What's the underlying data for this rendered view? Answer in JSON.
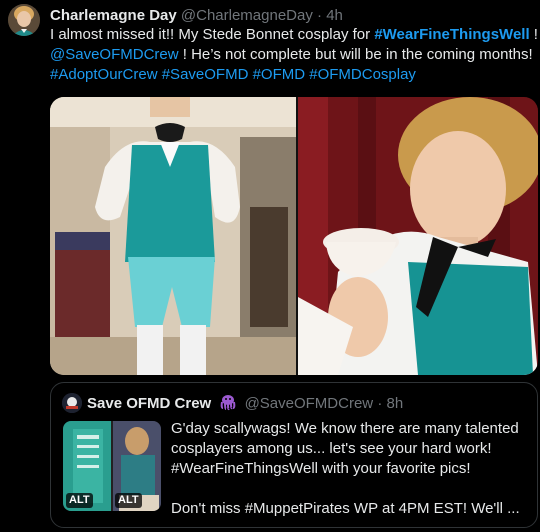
{
  "tweet": {
    "author_name": "Charlemagne Day",
    "author_handle": "@CharlemagneDay",
    "separator": "·",
    "time": "4h",
    "line1_pre": "I almost missed it!! My Stede Bonnet cosplay for ",
    "line1_tag": "#WearFineThingsWell",
    "line1_post": " !",
    "line2_mention": "@SaveOFMDCrew",
    "line2_text": " ! He’s not complete but will be in the coming months!",
    "line3_tags": "#AdoptOurCrew #SaveOFMD  #OFMD #OFMDCosplay"
  },
  "quote": {
    "author_name": "Save OFMD Crew",
    "emoji": "octopus-emoji",
    "author_handle": "@SaveOFMDCrew",
    "separator": "·",
    "time": "8h",
    "alt_badge_1": "ALT",
    "alt_badge_2": "ALT",
    "lines": [
      "G'day scallywags! We know there are many talented",
      "cosplayers among us... let's see your hard work!",
      "#WearFineThingsWell with your favorite pics!",
      "",
      "Don't miss #MuppetPirates WP at 4PM EST! We'll ..."
    ]
  },
  "colors": {
    "background": "#000000",
    "text": "#e7e9ea",
    "secondary": "#71767b",
    "link": "#1d9bf0",
    "border": "#2f3336"
  }
}
